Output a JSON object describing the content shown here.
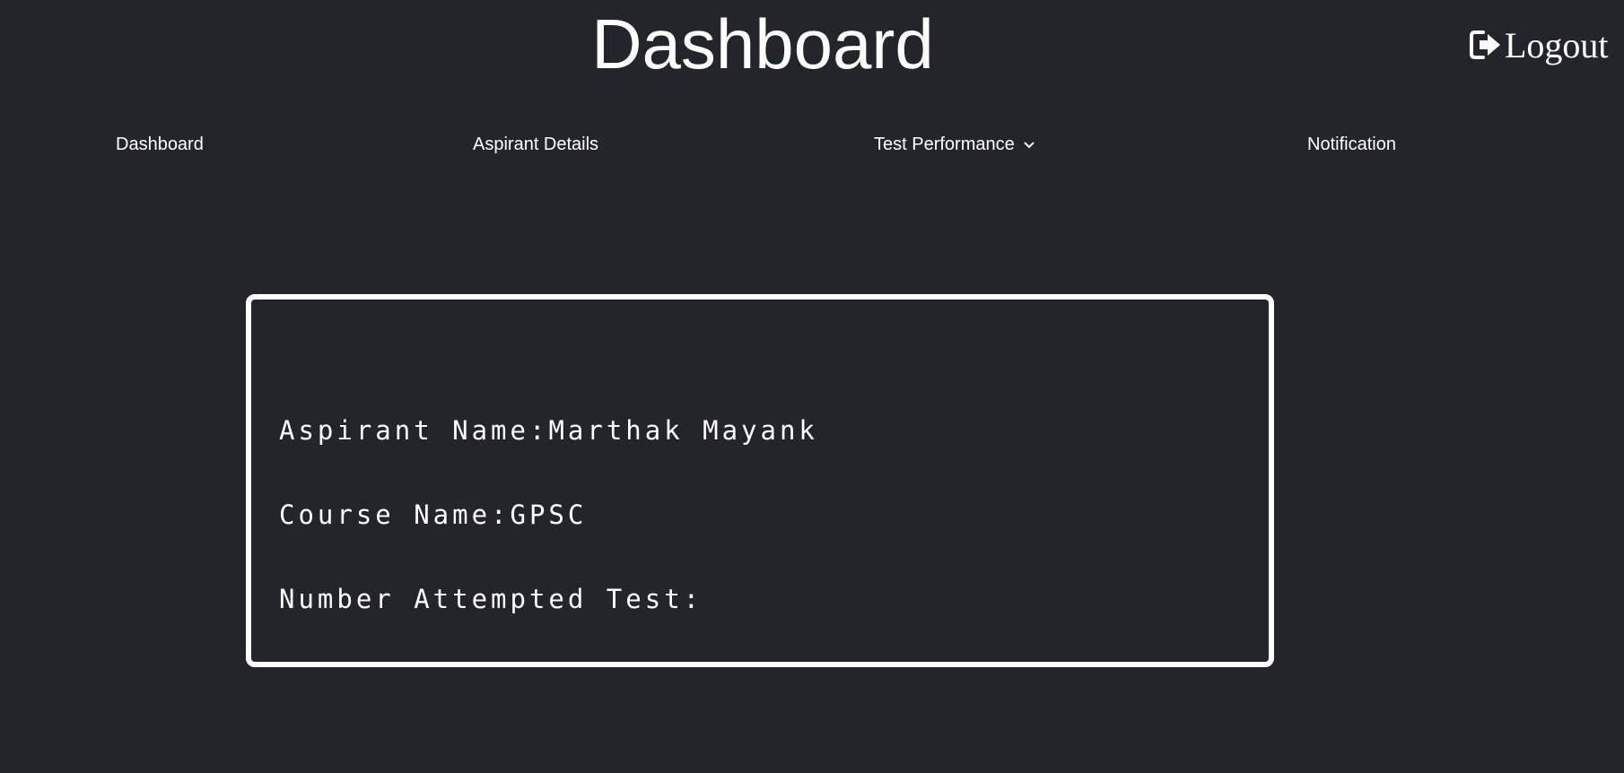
{
  "header": {
    "title": "Dashboard",
    "logout_label": "Logout",
    "logout_icon": "sign-out-icon"
  },
  "nav": {
    "items": [
      {
        "label": "Dashboard"
      },
      {
        "label": "Aspirant Details"
      },
      {
        "label": "Test Performance",
        "icon": "chevron-down-icon"
      },
      {
        "label": "Notification"
      }
    ]
  },
  "aspirant": {
    "name_label": "Aspirant Name:",
    "name_value": "Marthak Mayank",
    "course_label": "Course Name:",
    "course_value": "GPSC",
    "tests_label": "Number Attempted Test:",
    "tests_value": ""
  },
  "colors": {
    "background": "#222529",
    "text": "#ffffff"
  }
}
